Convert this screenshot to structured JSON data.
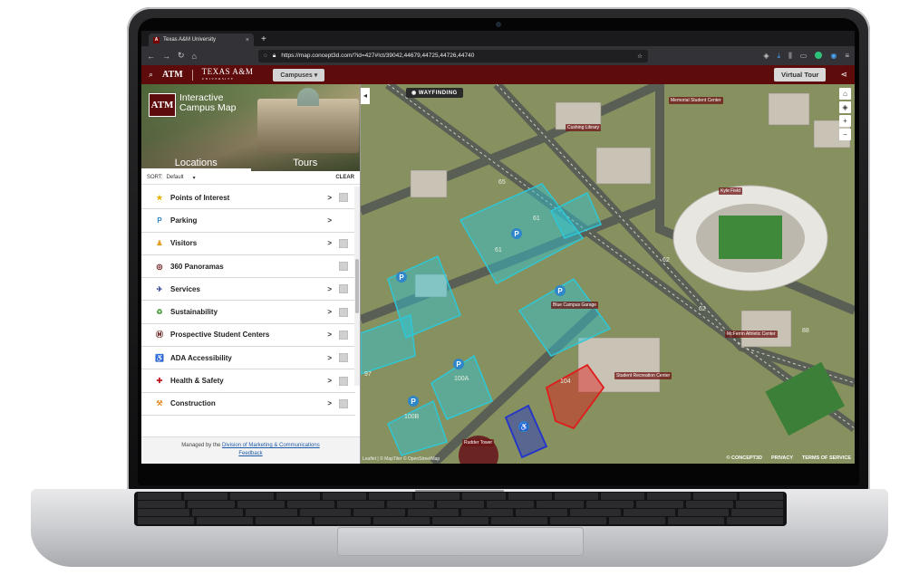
{
  "browser": {
    "tab_title": "Texas A&M University",
    "tab_close": "×",
    "new_tab": "+",
    "url": "https://map.concept3d.com/?id=427#!ct/39042,44679,44725,44726,44740"
  },
  "header": {
    "logo_mark": "ATM",
    "logo_text": "TEXAS A&M",
    "logo_sub": "UNIVERSITY",
    "campuses_label": "Campuses ▾",
    "virtual_tour_label": "Virtual Tour"
  },
  "sidebar": {
    "title": "Interactive Campus Map",
    "tabs": [
      "Locations",
      "Tours"
    ],
    "sort_label": "SORT:",
    "sort_value": "Default",
    "clear_label": "CLEAR",
    "categories": [
      {
        "label": "Points of Interest",
        "icon": "star-icon",
        "glyph": "★",
        "color": "#e8b400",
        "checkbox": true
      },
      {
        "label": "Parking",
        "icon": "parking-icon",
        "glyph": "P",
        "color": "#2f86c9",
        "checkbox": false
      },
      {
        "label": "Visitors",
        "icon": "visitor-icon",
        "glyph": "♟",
        "color": "#e39b1e",
        "checkbox": true
      },
      {
        "label": "360 Panoramas",
        "icon": "panorama-icon",
        "glyph": "◎",
        "color": "#5e0b0b",
        "checkbox": true
      },
      {
        "label": "Services",
        "icon": "services-icon",
        "glyph": "✈",
        "color": "#2a3f8f",
        "checkbox": true
      },
      {
        "label": "Sustainability",
        "icon": "sustainability-icon",
        "glyph": "♻",
        "color": "#4a9a3a",
        "checkbox": true
      },
      {
        "label": "Prospective Student Centers",
        "icon": "atm-icon",
        "glyph": "Ⓜ",
        "color": "#5e0b0b",
        "checkbox": true
      },
      {
        "label": "ADA Accessibility",
        "icon": "accessibility-icon",
        "glyph": "♿",
        "color": "#2f86c9",
        "checkbox": true
      },
      {
        "label": "Health & Safety",
        "icon": "health-icon",
        "glyph": "✚",
        "color": "#c0202b",
        "checkbox": true
      },
      {
        "label": "Construction",
        "icon": "construction-icon",
        "glyph": "⚒",
        "color": "#e0851a",
        "checkbox": true
      }
    ],
    "chevron": ">",
    "footer_prefix": "Managed by the",
    "footer_link": "Division of Marketing & Communications",
    "footer_feedback": "Feedback"
  },
  "map": {
    "wayfinding_label": "WAYFINDING",
    "zoom_in": "+",
    "zoom_out": "−",
    "home": "⌂",
    "collapse": "◂",
    "attribution": "Leaflet | © MapTiler © OpenStreetMap",
    "footer_links": [
      "© CONCEPT3D",
      "PRIVACY",
      "TERMS OF SERVICE"
    ],
    "lot_labels": [
      "61",
      "61",
      "62",
      "62",
      "88",
      "65",
      "97",
      "100A",
      "100B",
      "104",
      "7",
      "1"
    ],
    "place_labels": [
      "Kyle Field",
      "Student Recreation Center",
      "Memorial Student Center",
      "McFerrin Athletic Center",
      "Rudder Tower",
      "Cushing Library",
      "Blue Campus Garage"
    ],
    "colors": {
      "lot": "#2ec7d6",
      "lot_fill": "rgba(46,199,214,0.45)",
      "ada": "#2233cc",
      "construction": "#e01b1b"
    }
  }
}
